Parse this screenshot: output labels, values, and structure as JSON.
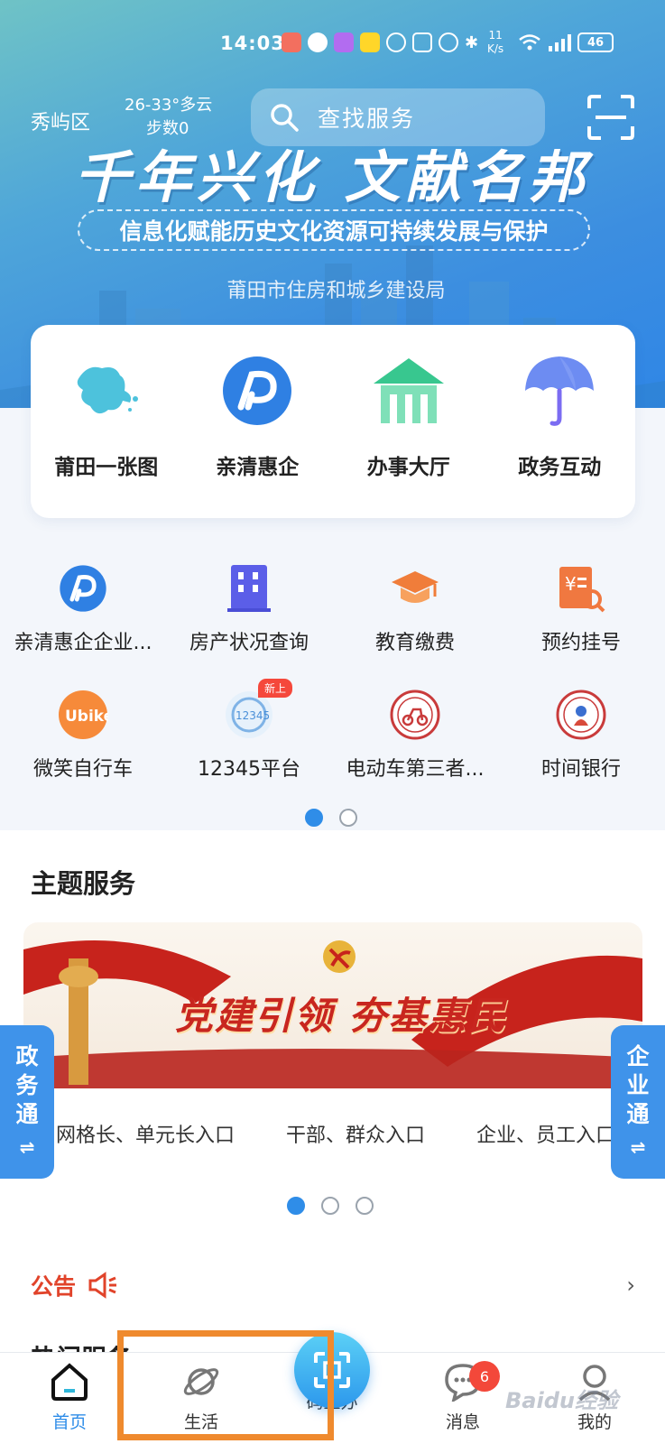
{
  "status_bar": {
    "time": "14:03",
    "speed_value": "11",
    "speed_unit": "K/s",
    "battery": "46"
  },
  "header": {
    "location": "秀屿区",
    "weather": "26-33°多云",
    "steps": "步数0",
    "search_placeholder": "查找服务"
  },
  "banner": {
    "title": "千年兴化 文献名邦",
    "subtitle": "信息化赋能历史文化资源可持续发展与保护",
    "org": "莆田市住房和城乡建设局"
  },
  "quick_services": [
    {
      "label": "莆田一张图",
      "icon": "map-icon"
    },
    {
      "label": "亲清惠企",
      "icon": "qinqing-logo-icon"
    },
    {
      "label": "办事大厅",
      "icon": "hall-icon"
    },
    {
      "label": "政务互动",
      "icon": "umbrella-icon"
    }
  ],
  "services": [
    {
      "label": "亲清惠企企业...",
      "icon": "qinqing-logo-icon"
    },
    {
      "label": "房产状况查询",
      "icon": "building-icon"
    },
    {
      "label": "教育缴费",
      "icon": "graduation-cap-icon"
    },
    {
      "label": "预约挂号",
      "icon": "receipt-icon"
    },
    {
      "label": "微笑自行车",
      "icon": "ubike-icon"
    },
    {
      "label": "12345平台",
      "icon": "hotline-12345-icon",
      "badge": "新上"
    },
    {
      "label": "电动车第三者...",
      "icon": "ebike-badge-icon"
    },
    {
      "label": "时间银行",
      "icon": "time-bank-icon"
    }
  ],
  "theme": {
    "section_title": "主题服务",
    "banner_text": "党建引领 夯基惠民",
    "links": [
      "网格长、单元长入口",
      "干部、群众入口",
      "企业、员工入口"
    ],
    "left_tab": [
      "政",
      "务",
      "通",
      "⇌"
    ],
    "right_tab": [
      "企",
      "业",
      "通",
      "⇌"
    ]
  },
  "notice": {
    "label": "公告"
  },
  "peek_title": "热门服务",
  "tabbar": {
    "home": "首页",
    "life": "生活",
    "code": "码上办",
    "messages": "消息",
    "messages_badge": "6",
    "mine": "我的"
  },
  "colors": {
    "primary": "#2f8de8",
    "notice": "#e1432a",
    "party_red": "#c8261f",
    "highlight": "#ef8a2e"
  },
  "watermark": "Baidu经验"
}
